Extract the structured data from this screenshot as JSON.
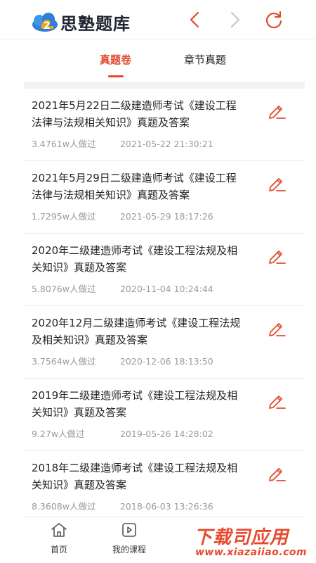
{
  "header": {
    "logo_text": "思塾题库"
  },
  "tabs": [
    {
      "label": "真题卷",
      "active": true
    },
    {
      "label": "章节真题",
      "active": false
    }
  ],
  "papers": [
    {
      "title": "2021年5月22日二级建造师考试《建设工程法律与法规相关知识》真题及答案",
      "count": "3.4761w人做过",
      "date": "2021-05-22 21:30:21"
    },
    {
      "title": "2021年5月29日二级建造师考试《建设工程法律与法规相关知识》真题及答案",
      "count": "1.7295w人做过",
      "date": "2021-05-29 18:17:26"
    },
    {
      "title": "2020年二级建造师考试《建设工程法规及相关知识》真题及答案",
      "count": "5.8076w人做过",
      "date": "2020-11-04 10:24:44"
    },
    {
      "title": "2020年12月二级建造师考试《建设工程法规及相关知识》真题及答案",
      "count": "3.7564w人做过",
      "date": "2020-12-06 18:13:50"
    },
    {
      "title": "2019年二级建造师考试《建设工程法规及相关知识》真题及答案",
      "count": "9.27w人做过",
      "date": "2019-05-26 14:28:02"
    },
    {
      "title": "2018年二级建造师考试《建设工程法规及相关知识》真题及答案",
      "count": "8.3608w人做过",
      "date": "2018-06-03 13:26:36"
    }
  ],
  "bottom_nav": {
    "home": "首页",
    "my_courses": "我的课程"
  },
  "watermark": {
    "big": "下载司应用",
    "small": "www.xiazaiiao.com"
  },
  "colors": {
    "accent": "#e04a2e",
    "nav_disabled": "#c8c8c8",
    "logo_blue": "#2f7fd8",
    "logo_orange": "#f3a21a"
  }
}
